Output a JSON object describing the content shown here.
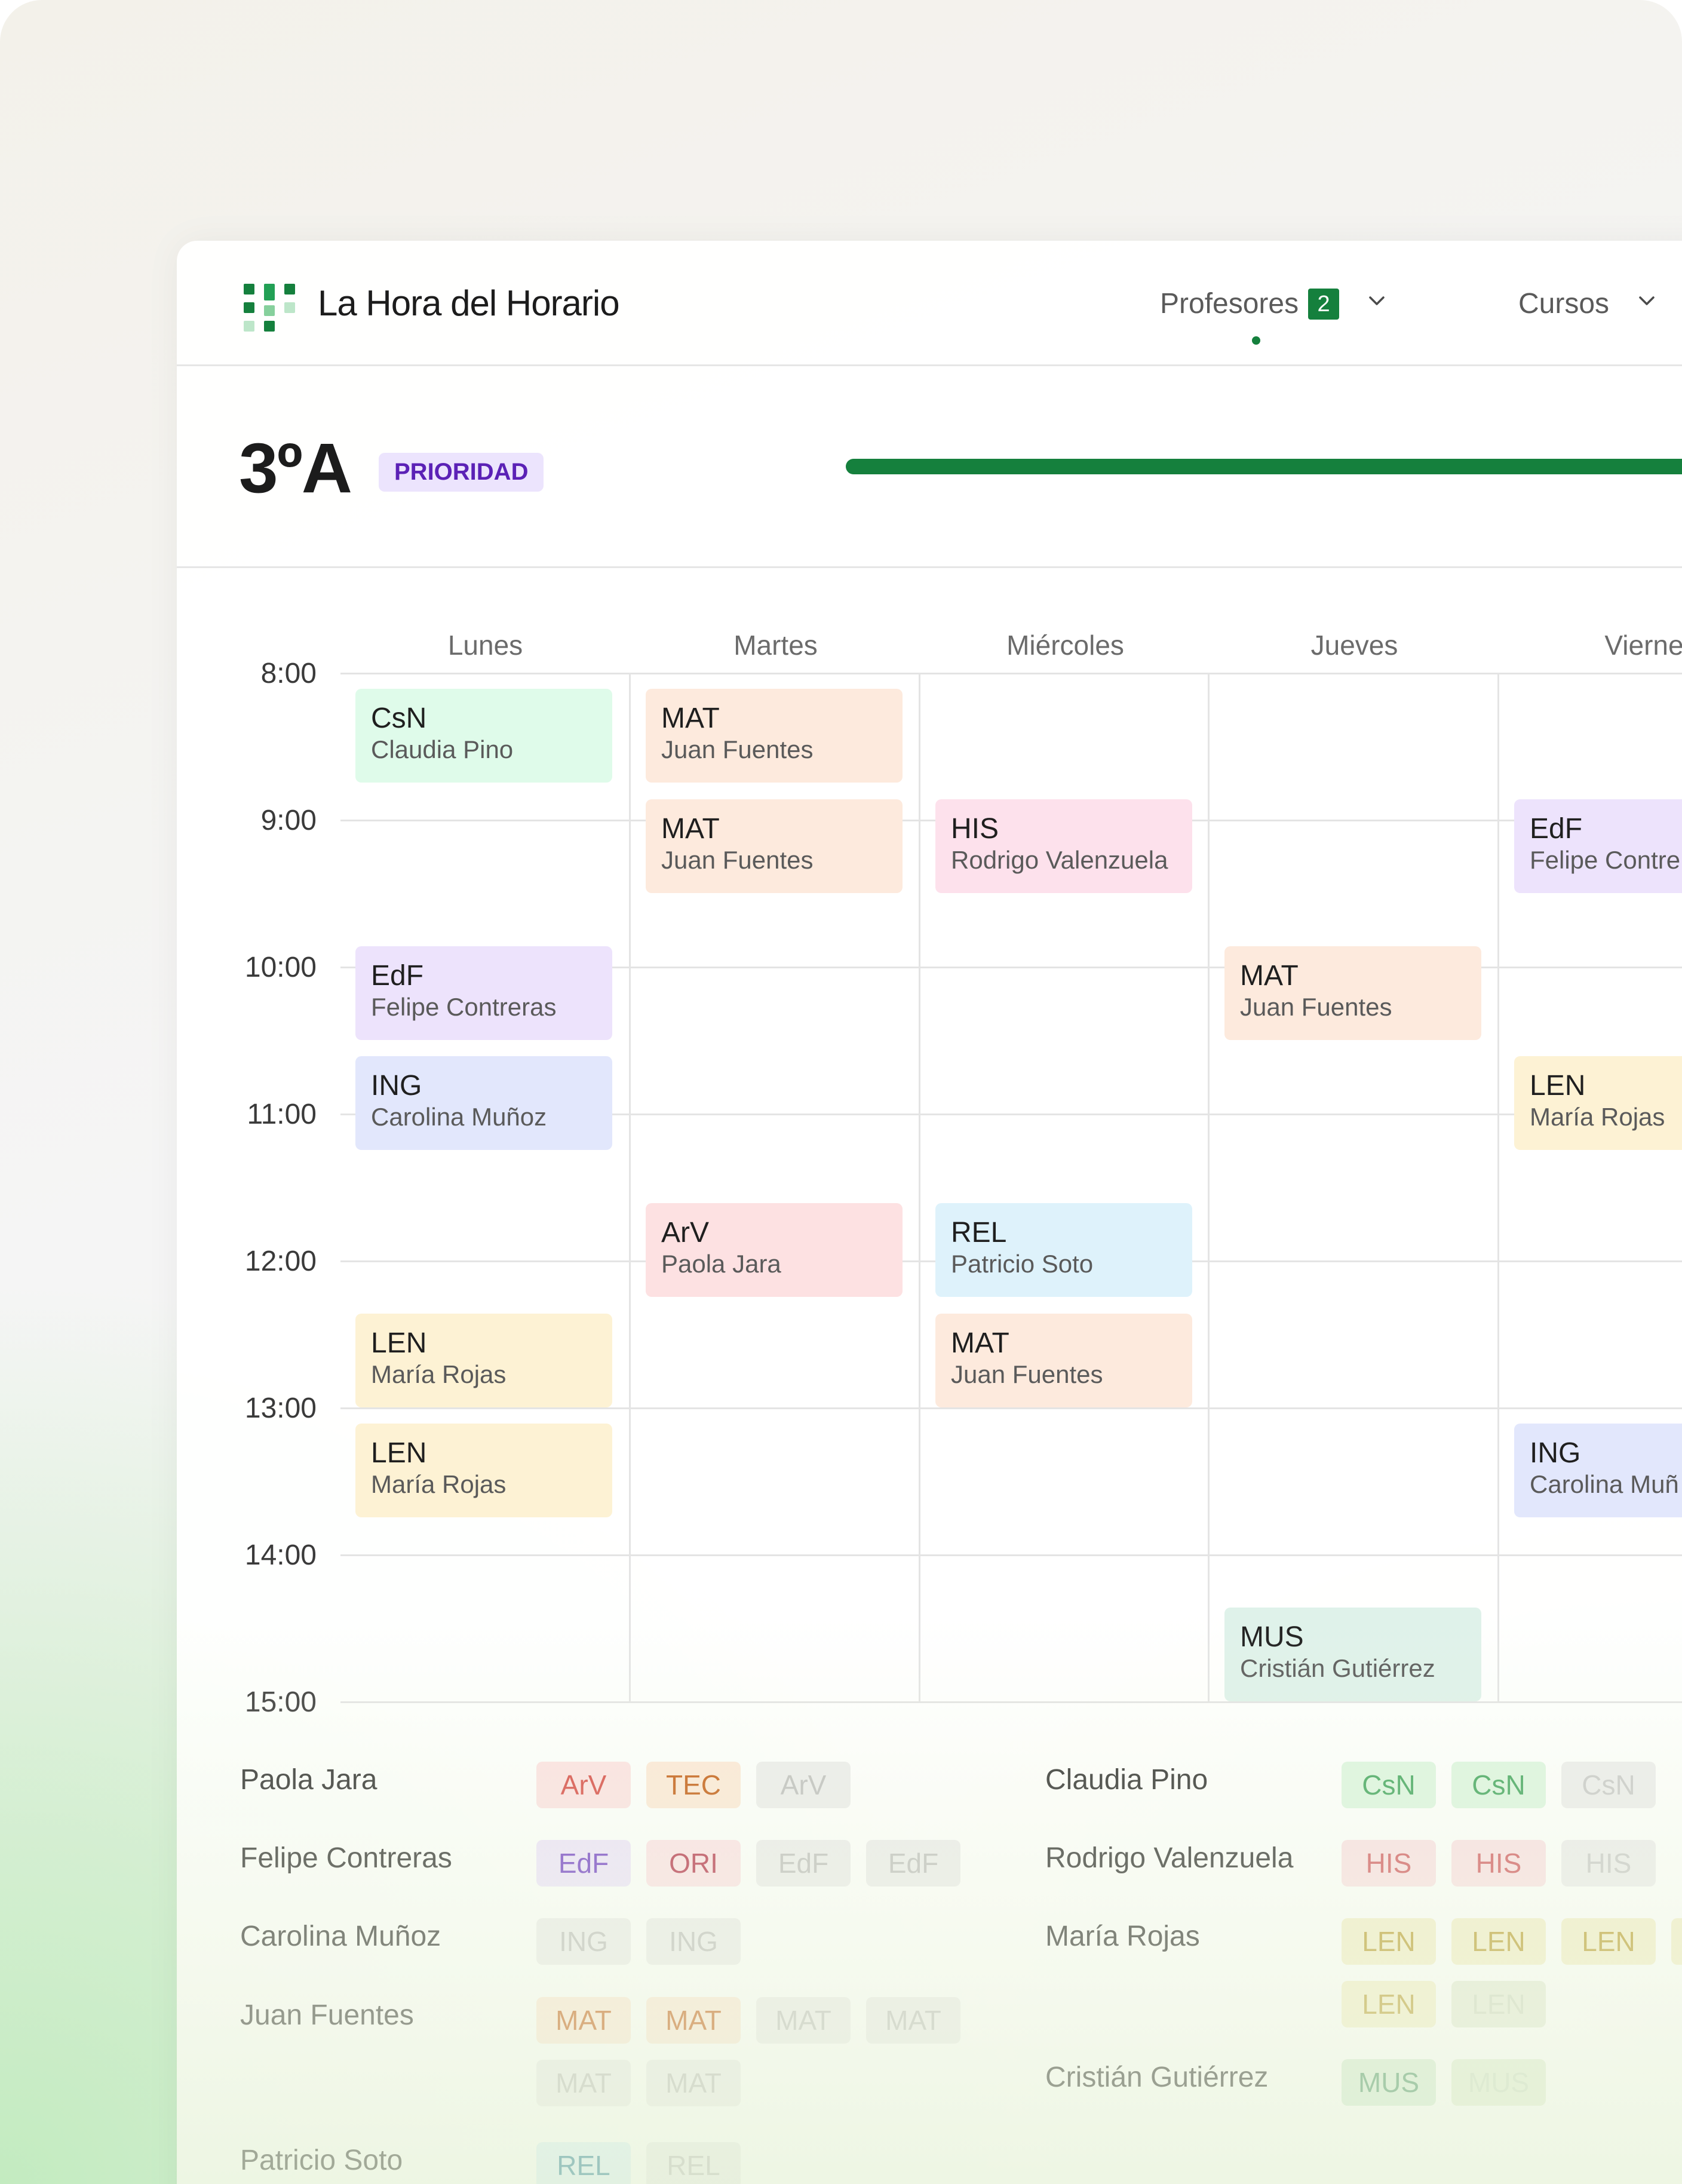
{
  "app": {
    "title": "La Hora del Horario",
    "logo_icon": "grid-logo-icon"
  },
  "nav": {
    "profesores_label": "Profesores",
    "profesores_count": "2",
    "cursos_label": "Cursos"
  },
  "course": {
    "name": "3ºA",
    "badge": "PRIORIDAD",
    "progress_fraction": 1.0
  },
  "schedule": {
    "days": [
      "Lunes",
      "Martes",
      "Miércoles",
      "Jueves",
      "Vierne"
    ],
    "times": [
      "8:00",
      "9:00",
      "10:00",
      "11:00",
      "12:00",
      "13:00",
      "14:00",
      "15:00"
    ],
    "events": [
      {
        "day": 0,
        "start": "8:00",
        "subject": "CsN",
        "teacher": "Claudia Pino",
        "color": "#dffbea"
      },
      {
        "day": 1,
        "start": "8:00",
        "subject": "MAT",
        "teacher": "Juan Fuentes",
        "color": "#fdeadd"
      },
      {
        "day": 1,
        "start": "8:45",
        "subject": "MAT",
        "teacher": "Juan Fuentes",
        "color": "#fdeadd"
      },
      {
        "day": 2,
        "start": "8:45",
        "subject": "HIS",
        "teacher": "Rodrigo Valenzuela",
        "color": "#fde1ec"
      },
      {
        "day": 4,
        "start": "8:45",
        "subject": "EdF",
        "teacher": "Felipe Contre",
        "color": "#ede3fc"
      },
      {
        "day": 0,
        "start": "9:45",
        "subject": "EdF",
        "teacher": "Felipe Contreras",
        "color": "#ede3fc"
      },
      {
        "day": 3,
        "start": "9:45",
        "subject": "MAT",
        "teacher": "Juan Fuentes",
        "color": "#fdeadd"
      },
      {
        "day": 0,
        "start": "10:30",
        "subject": "ING",
        "teacher": "Carolina Muñoz",
        "color": "#e2e7fc"
      },
      {
        "day": 4,
        "start": "10:30",
        "subject": "LEN",
        "teacher": "María Rojas",
        "color": "#fdf2d4"
      },
      {
        "day": 1,
        "start": "11:30",
        "subject": "ArV",
        "teacher": "Paola Jara",
        "color": "#fde1e2"
      },
      {
        "day": 2,
        "start": "11:30",
        "subject": "REL",
        "teacher": "Patricio Soto",
        "color": "#def2fb"
      },
      {
        "day": 0,
        "start": "12:15",
        "subject": "LEN",
        "teacher": "María Rojas",
        "color": "#fdf2d4"
      },
      {
        "day": 2,
        "start": "12:15",
        "subject": "MAT",
        "teacher": "Juan Fuentes",
        "color": "#fdeadd"
      },
      {
        "day": 0,
        "start": "13:00",
        "subject": "LEN",
        "teacher": "María Rojas",
        "color": "#fdf2d4"
      },
      {
        "day": 4,
        "start": "13:00",
        "subject": "ING",
        "teacher": "Carolina Muñ",
        "color": "#e2e7fc"
      },
      {
        "day": 3,
        "start": "14:15",
        "subject": "MUS",
        "teacher": "Cristián Gutiérrez",
        "color": "#dff2ea"
      }
    ]
  },
  "teachers_left": [
    {
      "name": "Paola Jara",
      "chips": [
        {
          "label": "ArV",
          "bg": "#fde1e2",
          "fg": "#d6453f"
        },
        {
          "label": "TEC",
          "bg": "#fde8d6",
          "fg": "#c2570c"
        },
        {
          "label": "ArV",
          "bg": "#ececec",
          "fg": "#bdbdbd"
        }
      ]
    },
    {
      "name": "Felipe Contreras",
      "chips": [
        {
          "label": "EdF",
          "bg": "#ede3fc",
          "fg": "#6d39c4"
        },
        {
          "label": "ORI",
          "bg": "#fde1e6",
          "fg": "#b32d46"
        },
        {
          "label": "EdF",
          "bg": "#ececec",
          "fg": "#bdbdbd"
        },
        {
          "label": "EdF",
          "bg": "#ececec",
          "fg": "#bdbdbd"
        }
      ]
    },
    {
      "name": "Carolina Muñoz",
      "chips": [
        {
          "label": "ING",
          "bg": "#ececec",
          "fg": "#bdbdbd"
        },
        {
          "label": "ING",
          "bg": "#ececec",
          "fg": "#bdbdbd"
        }
      ]
    },
    {
      "name": "Juan Fuentes",
      "chips": [
        {
          "label": "MAT",
          "bg": "#fde8d6",
          "fg": "#c2570c"
        },
        {
          "label": "MAT",
          "bg": "#fde8d6",
          "fg": "#c2570c"
        },
        {
          "label": "MAT",
          "bg": "#ececec",
          "fg": "#bdbdbd"
        },
        {
          "label": "MAT",
          "bg": "#ececec",
          "fg": "#bdbdbd"
        },
        {
          "label": "MAT",
          "bg": "#ececec",
          "fg": "#bdbdbd"
        },
        {
          "label": "MAT",
          "bg": "#ececec",
          "fg": "#bdbdbd"
        }
      ]
    },
    {
      "name": "Patricio Soto",
      "chips": [
        {
          "label": "REL",
          "bg": "#dcf1fa",
          "fg": "#1f7a96"
        },
        {
          "label": "REL",
          "bg": "#ececec",
          "fg": "#bdbdbd"
        }
      ]
    }
  ],
  "teachers_right": [
    {
      "name": "Claudia Pino",
      "chips": [
        {
          "label": "CsN",
          "bg": "#dcf5df",
          "fg": "#3ea35a"
        },
        {
          "label": "CsN",
          "bg": "#dcf5df",
          "fg": "#3ea35a"
        },
        {
          "label": "CsN",
          "bg": "#ececec",
          "fg": "#c8c8c8"
        }
      ]
    },
    {
      "name": "Rodrigo Valenzuela",
      "chips": [
        {
          "label": "HIS",
          "bg": "#fbe0e4",
          "fg": "#d0565c"
        },
        {
          "label": "HIS",
          "bg": "#fbe0e4",
          "fg": "#d0565c"
        },
        {
          "label": "HIS",
          "bg": "#ececec",
          "fg": "#c8c8c8"
        }
      ]
    },
    {
      "name": "María Rojas",
      "chips": [
        {
          "label": "LEN",
          "bg": "#f4efc8",
          "fg": "#b99b2a"
        },
        {
          "label": "LEN",
          "bg": "#f4efc8",
          "fg": "#b99b2a"
        },
        {
          "label": "LEN",
          "bg": "#f4efc8",
          "fg": "#b99b2a"
        },
        {
          "label": "LEN",
          "bg": "#f4efc8",
          "fg": "#b99b2a"
        },
        {
          "label": "LEN",
          "bg": "#f4efc8",
          "fg": "#b99b2a"
        },
        {
          "label": "LEN",
          "bg": "#e5ecd8",
          "fg": "#cfd8c2"
        }
      ]
    },
    {
      "name": "Cristián Gutiérrez",
      "chips": [
        {
          "label": "MUS",
          "bg": "#d5edd5",
          "fg": "#4a9466"
        },
        {
          "label": "MUS",
          "bg": "#e2efd6",
          "fg": "#cfdfc7"
        }
      ]
    }
  ]
}
